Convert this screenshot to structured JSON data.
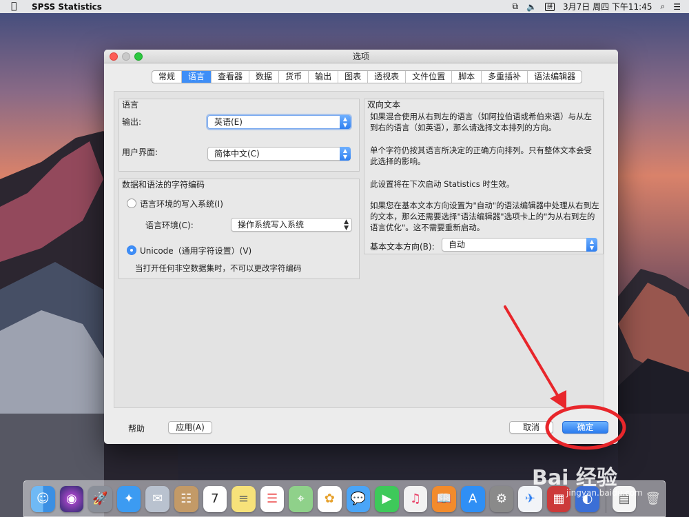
{
  "menubar": {
    "app_name": "SPSS Statistics",
    "date_time": "3月7日 周四 下午11:45"
  },
  "window": {
    "title": "选项"
  },
  "tabs": [
    {
      "label": "常规"
    },
    {
      "label": "语言",
      "active": true
    },
    {
      "label": "查看器"
    },
    {
      "label": "数据"
    },
    {
      "label": "货币"
    },
    {
      "label": "输出"
    },
    {
      "label": "图表"
    },
    {
      "label": "透视表"
    },
    {
      "label": "文件位置"
    },
    {
      "label": "脚本"
    },
    {
      "label": "多重插补"
    },
    {
      "label": "语法编辑器"
    }
  ],
  "language": {
    "title": "语言",
    "output_label": "输出:",
    "output_value": "英语(E)",
    "ui_label": "用户界面:",
    "ui_value": "简体中文(C)"
  },
  "encoding": {
    "title": "数据和语法的字符编码",
    "locale_system_label": "语言环境的写入系统(I)",
    "locale_label": "语言环境(C):",
    "locale_value": "操作系统写入系统",
    "unicode_label": "Unicode（通用字符设置）(V)",
    "note": "当打开任何非空数据集时，不可以更改字符编码"
  },
  "bidi": {
    "title": "双向文本",
    "para1_line1": "如果混合使用从右到左的语言（如阿拉伯语或希伯来语）与从左",
    "para1_line2": "到右的语言（如英语），那么请选择文本排列的方向。",
    "para2_line1": "单个字符仍按其语言所决定的正确方向排列。只有整体文本会受",
    "para2_line2": "此选择的影响。",
    "para3": "此设置将在下次启动 Statistics 时生效。",
    "para4_line1": "如果您在基本文本方向设置为\"自动\"的语法编辑器中处理从右到左",
    "para4_line2": "的文本，那么还需要选择\"语法编辑器\"选项卡上的\"为从右到左的",
    "para4_line3": "语言优化\"。这不需要重新启动。",
    "direction_label": "基本文本方向(B):",
    "direction_value": "自动"
  },
  "buttons": {
    "help": "帮助",
    "apply": "应用(A)",
    "cancel": "取消",
    "ok": "确定"
  },
  "watermark": {
    "text": "Bai 经验",
    "sub": "jingyan.baidu.com"
  },
  "colors": {
    "accent": "#3e8ef7",
    "annotation": "#e8262b"
  }
}
